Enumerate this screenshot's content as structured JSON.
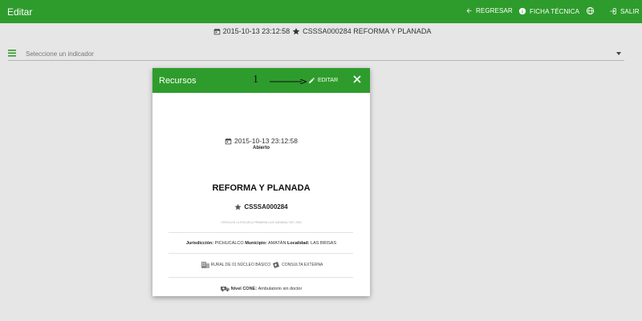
{
  "app": {
    "title": "Editar"
  },
  "topnav": {
    "regresar_label": "REGRESAR",
    "ficha_label": "FICHA TÉCNICA",
    "salir_label": "SALIR",
    "globe_icon": "globe-icon"
  },
  "subheader": {
    "datetime": "2015-10-13 23:12:58",
    "record": "CSSSA000284 REFORMA Y PLANADA"
  },
  "indicator": {
    "placeholder": "Seleccione un indicador"
  },
  "card": {
    "title": "Recursos",
    "annotation_number": "1",
    "edit_label": "EDITAR",
    "datetime": "2015-10-13 23:12:58",
    "status": "Abierto",
    "name": "REFORMA Y PLANADA",
    "code": "CSSSA000284",
    "tiny_note": "CERCA DE LA ESCUELA PRIMARIA LUIS SARABIA / DIP. 2000",
    "jurisdiccion_label": "Jurisdicción:",
    "jurisdiccion": "PICHUCALCO",
    "municipio_label": "Municipio:",
    "municipio": "AMATÁN",
    "localidad_label": "Localidad:",
    "localidad": "LAS BRISAS",
    "tipo": "RURAL DE 01 NÚCLEO BÁSICO",
    "servicio": "CONSULTA EXTERNA",
    "nivel_label": "Nivel CONE:",
    "nivel": "Ambulatorio sin doctor"
  },
  "colors": {
    "brand_green": "#2e9c2c",
    "background": "#e6e6e6"
  }
}
